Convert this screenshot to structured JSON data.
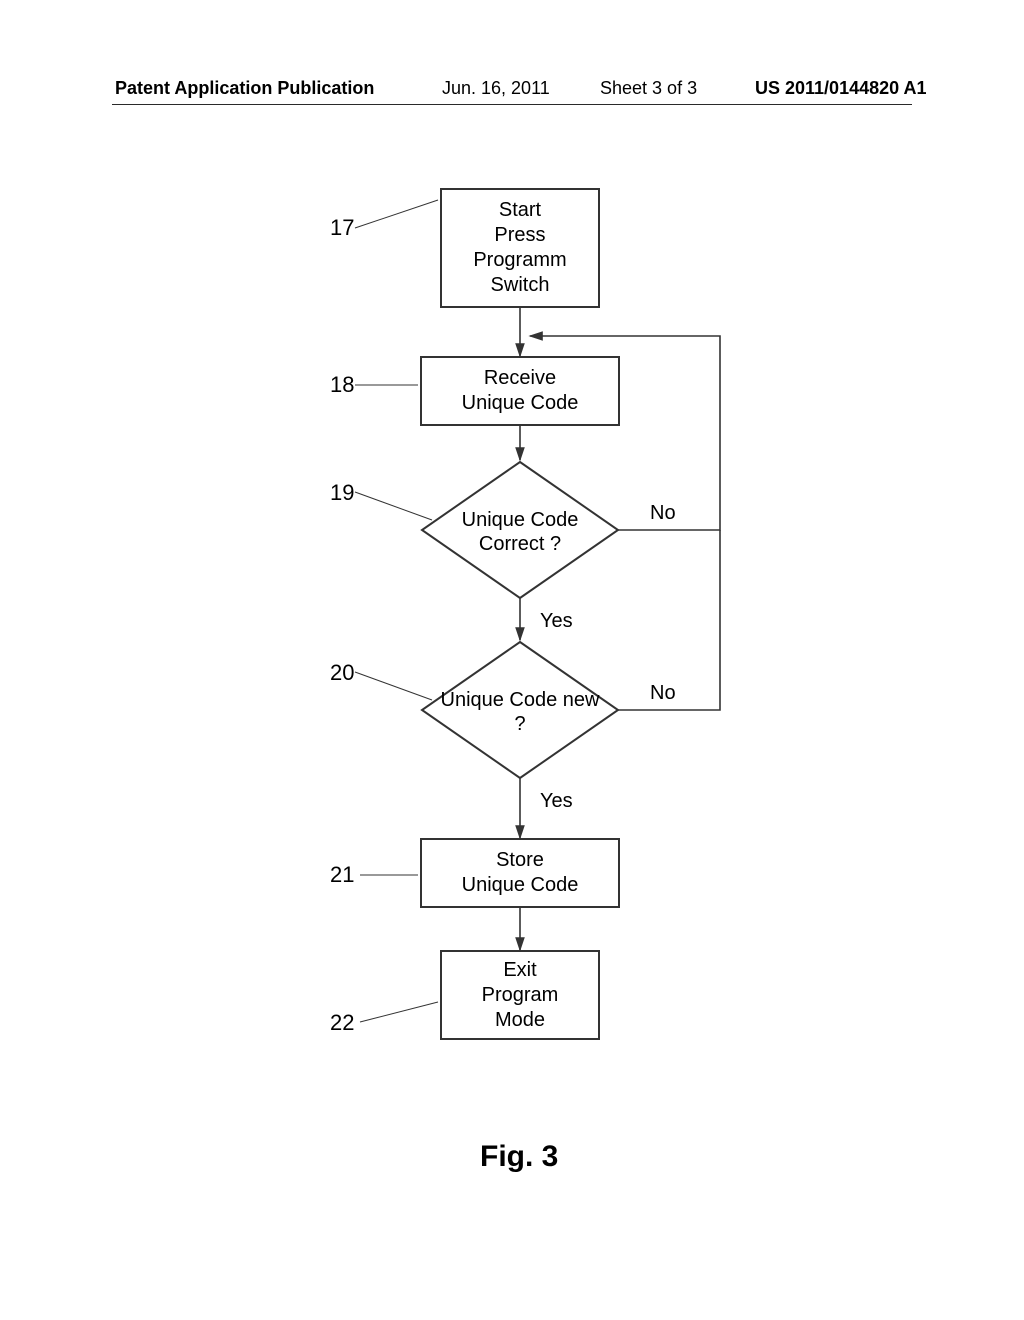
{
  "header": {
    "publication_label": "Patent Application Publication",
    "date": "Jun. 16, 2011",
    "sheet": "Sheet 3 of 3",
    "pub_number": "US 2011/0144820 A1"
  },
  "flow": {
    "node17": "Start\nPress\nProgramm\nSwitch",
    "node18": "Receive\nUnique Code",
    "node19": "Unique Code\nCorrect ?",
    "node20": "Unique Code\nnew ?",
    "node21": "Store\nUnique Code",
    "node22": "Exit\nProgram\nMode",
    "ref17": "17",
    "ref18": "18",
    "ref19": "19",
    "ref20": "20",
    "ref21": "21",
    "ref22": "22",
    "edge19_no": "No",
    "edge19_yes": "Yes",
    "edge20_no": "No",
    "edge20_yes": "Yes"
  },
  "figure_caption": "Fig. 3",
  "chart_data": {
    "type": "flowchart",
    "nodes": [
      {
        "id": 17,
        "shape": "rect",
        "text": "Start Press Programm Switch"
      },
      {
        "id": 18,
        "shape": "rect",
        "text": "Receive Unique Code"
      },
      {
        "id": 19,
        "shape": "diamond",
        "text": "Unique Code Correct ?"
      },
      {
        "id": 20,
        "shape": "diamond",
        "text": "Unique Code new ?"
      },
      {
        "id": 21,
        "shape": "rect",
        "text": "Store Unique Code"
      },
      {
        "id": 22,
        "shape": "rect",
        "text": "Exit Program Mode"
      }
    ],
    "edges": [
      {
        "from": 17,
        "to": 18,
        "label": ""
      },
      {
        "from": 18,
        "to": 19,
        "label": ""
      },
      {
        "from": 19,
        "to": 20,
        "label": "Yes"
      },
      {
        "from": 19,
        "to": 18,
        "label": "No"
      },
      {
        "from": 20,
        "to": 21,
        "label": "Yes"
      },
      {
        "from": 20,
        "to": 18,
        "label": "No"
      },
      {
        "from": 21,
        "to": 22,
        "label": ""
      }
    ]
  }
}
